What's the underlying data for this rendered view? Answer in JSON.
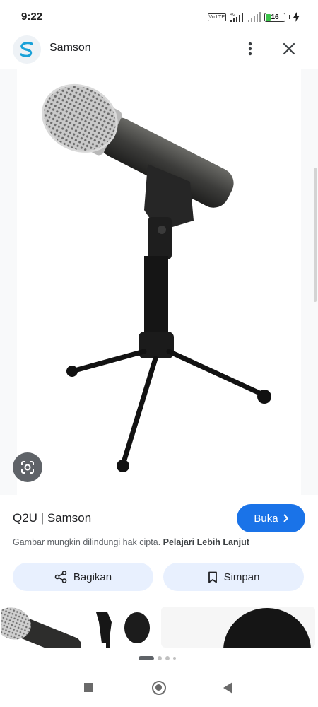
{
  "status": {
    "time": "9:22",
    "network": "4G",
    "volte": "Vo LTE",
    "battery": "16"
  },
  "header": {
    "site_name": "Samson",
    "icons": {
      "logo": "samson-logo-icon",
      "more": "more-vert-icon",
      "close": "close-icon"
    }
  },
  "result": {
    "title": "Q2U | Samson",
    "visit_label": "Buka",
    "copyright_notice": "Gambar mungkin dilindungi hak cipta.",
    "learn_more": "Pelajari Lebih Lanjut"
  },
  "actions": {
    "share_label": "Bagikan",
    "save_label": "Simpan"
  },
  "colors": {
    "accent": "#1a73e8",
    "pill_bg": "#e8f0fe",
    "lens_bg": "#5f6368"
  }
}
